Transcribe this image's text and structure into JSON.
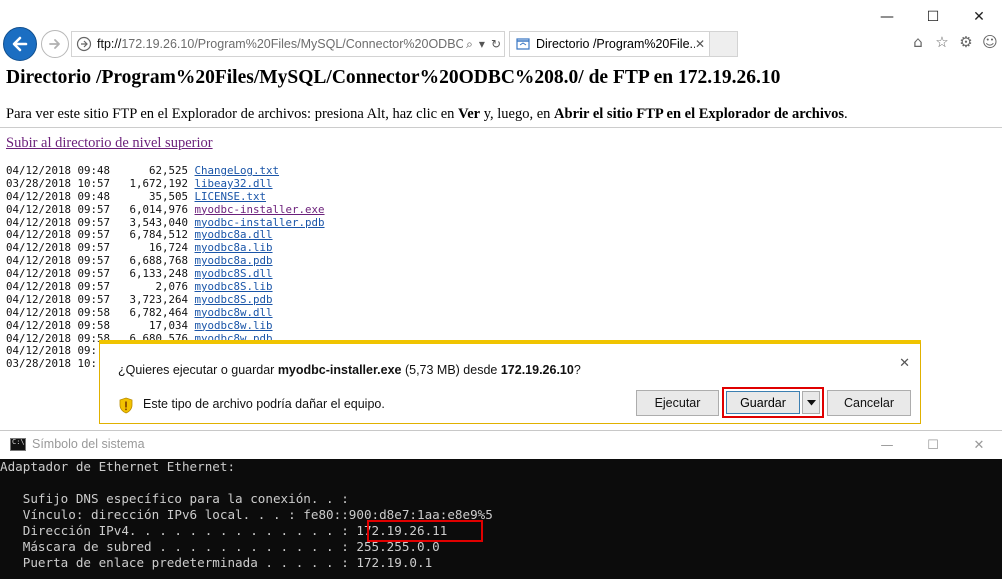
{
  "browser": {
    "address_url": "ftp://172.19.26.10/Program%20Files/MySQL/Connector%20ODBC%",
    "address_url_prefix": "ftp://",
    "address_url_rest": "172.19.26.10/Program%20Files/MySQL/Connector%20ODBC%",
    "tab_title": "Directorio /Program%20File...",
    "window_controls": {
      "minimize": "—",
      "maximize": "☐",
      "close": "✕"
    },
    "icons": [
      "back-icon",
      "forward-icon",
      "search-icon",
      "dropdown-icon",
      "refresh-icon",
      "home-icon",
      "favorites-star-icon",
      "settings-gear-icon",
      "smiley-icon"
    ]
  },
  "page": {
    "title": "Directorio /Program%20Files/MySQL/Connector%20ODBC%208.0/ de FTP en 172.19.26.10",
    "hint_parts": [
      "Para ver este sitio FTP en el Explorador de archivos: presiona Alt, haz clic en ",
      "Ver",
      " y, luego, en ",
      "Abrir el sitio FTP en el Explorador de archivos",
      "."
    ],
    "up_link": "Subir al directorio de nivel superior",
    "files": [
      {
        "date": "04/12/2018",
        "time": "09:48",
        "size": "62,525",
        "name": "ChangeLog.txt",
        "visited": false
      },
      {
        "date": "03/28/2018",
        "time": "10:57",
        "size": "1,672,192",
        "name": "libeay32.dll",
        "visited": false
      },
      {
        "date": "04/12/2018",
        "time": "09:48",
        "size": "35,505",
        "name": "LICENSE.txt",
        "visited": false
      },
      {
        "date": "04/12/2018",
        "time": "09:57",
        "size": "6,014,976",
        "name": "myodbc-installer.exe",
        "visited": true
      },
      {
        "date": "04/12/2018",
        "time": "09:57",
        "size": "3,543,040",
        "name": "myodbc-installer.pdb",
        "visited": false
      },
      {
        "date": "04/12/2018",
        "time": "09:57",
        "size": "6,784,512",
        "name": "myodbc8a.dll",
        "visited": false
      },
      {
        "date": "04/12/2018",
        "time": "09:57",
        "size": "16,724",
        "name": "myodbc8a.lib",
        "visited": false
      },
      {
        "date": "04/12/2018",
        "time": "09:57",
        "size": "6,688,768",
        "name": "myodbc8a.pdb",
        "visited": false
      },
      {
        "date": "04/12/2018",
        "time": "09:57",
        "size": "6,133,248",
        "name": "myodbc8S.dll",
        "visited": false
      },
      {
        "date": "04/12/2018",
        "time": "09:57",
        "size": "2,076",
        "name": "myodbc8S.lib",
        "visited": false
      },
      {
        "date": "04/12/2018",
        "time": "09:57",
        "size": "3,723,264",
        "name": "myodbc8S.pdb",
        "visited": false
      },
      {
        "date": "04/12/2018",
        "time": "09:58",
        "size": "6,782,464",
        "name": "myodbc8w.dll",
        "visited": false
      },
      {
        "date": "04/12/2018",
        "time": "09:58",
        "size": "17,034",
        "name": "myodbc8w.lib",
        "visited": false
      },
      {
        "date": "04/12/2018",
        "time": "09:58",
        "size": "6,680,576",
        "name": "myodbc8w.pdb",
        "visited": false
      },
      {
        "date": "04/12/2018",
        "time": "09:",
        "size": "",
        "name": "",
        "visited": false
      },
      {
        "date": "03/28/2018",
        "time": "10:",
        "size": "",
        "name": "",
        "visited": false
      }
    ]
  },
  "notification": {
    "question_prefix": "¿Quieres ejecutar o guardar ",
    "file_name": "myodbc-installer.exe",
    "question_size": " (5,73 MB) desde ",
    "host": "172.19.26.10",
    "question_suffix": "?",
    "warning": "Este tipo de archivo podría dañar el equipo.",
    "buttons": {
      "run": "Ejecutar",
      "save": "Guardar",
      "cancel": "Cancelar"
    },
    "close": "✕",
    "highlight_color": "#e00000"
  },
  "cmd": {
    "title": "Símbolo del sistema",
    "controls": {
      "minimize": "—",
      "maximize": "☐",
      "close": "✕"
    },
    "lines": [
      "Adaptador de Ethernet Ethernet:",
      "",
      "   Sufijo DNS específico para la conexión. . :",
      "   Vínculo: dirección IPv6 local. . . : fe80::900:d8e7:1aa:e8e9%5",
      "   Dirección IPv4. . . . . . . . . . . . . . : 172.19.26.11",
      "   Máscara de subred . . . . . . . . . . . . : 255.255.0.0",
      "   Puerta de enlace predeterminada . . . . . : 172.19.0.1"
    ]
  }
}
